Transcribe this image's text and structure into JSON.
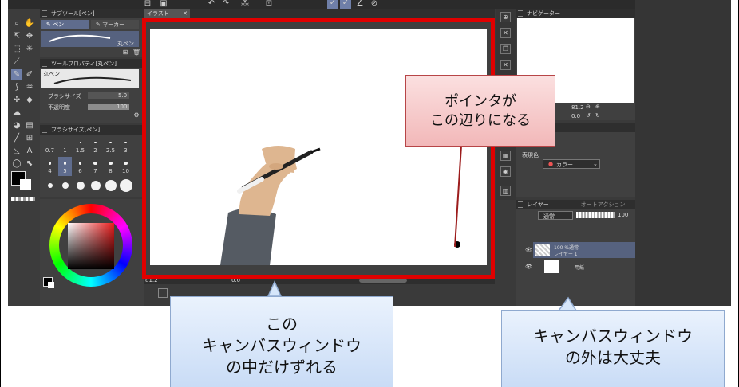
{
  "tabs": {
    "canvas_tab": "イラスト"
  },
  "sub_tool": {
    "header": "サブツール[ペン]",
    "tab_pen": "ペン",
    "tab_marker": "マーカー",
    "brush_name": "丸ペン"
  },
  "tool_property": {
    "header": "ツールプロパティ[丸ペン]",
    "preset": "丸ペン",
    "brush_size_label": "ブラシサイズ",
    "brush_size_value": "5.0",
    "opacity_label": "不透明度",
    "opacity_value": "100"
  },
  "brush_size": {
    "header": "ブラシサイズ[ペン]",
    "row1": [
      "0.7",
      "1",
      "1.5",
      "2",
      "2.5",
      "3"
    ],
    "row2": [
      "4",
      "5",
      "6",
      "7",
      "8",
      "10"
    ],
    "selected_index": 7
  },
  "navigator": {
    "header": "ナビゲーター",
    "zoom": "81.2",
    "rotation": "0.0"
  },
  "color_panel": {
    "label": "表現色",
    "value": "カラー"
  },
  "layer": {
    "header": "レイヤー",
    "tab2": "オートアクション",
    "blend_mode": "通常",
    "opacity": "100",
    "layers": [
      {
        "mode": "100 %通常",
        "name": "レイヤー 1"
      },
      {
        "mode": "",
        "name": "用紙"
      }
    ]
  },
  "status": {
    "zoom": "81.2",
    "angle": "0.0"
  },
  "callouts": {
    "pointer": [
      "ポインタが",
      "この辺りになる"
    ],
    "inside": [
      "この",
      "キャンバスウィンドウ",
      "の中だけずれる"
    ],
    "outside": [
      "キャンバスウィンドウ",
      "の外は大丈夫"
    ]
  },
  "colors": {
    "highlight": "#e00000",
    "ui_bg": "#3a3a3a",
    "callout_blue": "#cfe0f6",
    "callout_pink": "#f6c9ca"
  }
}
